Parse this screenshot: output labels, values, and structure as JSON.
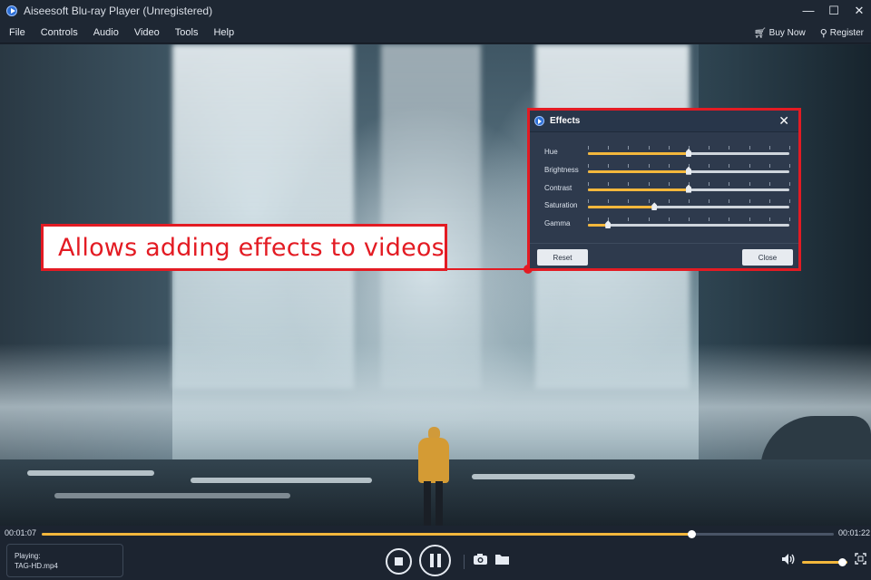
{
  "window": {
    "title": "Aiseesoft Blu-ray Player (Unregistered)",
    "minimize": "—",
    "maximize": "☐",
    "close": "✕"
  },
  "menu": {
    "items": [
      "File",
      "Controls",
      "Audio",
      "Video",
      "Tools",
      "Help"
    ],
    "buy_now": "Buy Now",
    "register": "Register"
  },
  "annotation": {
    "text": "Allows adding effects to videos",
    "color": "#e31b23"
  },
  "effects_dialog": {
    "title": "Effects",
    "close_glyph": "✕",
    "sliders": [
      {
        "label": "Hue",
        "value": 0.5,
        "show_fill": true
      },
      {
        "label": "Brightness",
        "value": 0.5,
        "show_fill": true
      },
      {
        "label": "Contrast",
        "value": 0.5,
        "show_fill": true
      },
      {
        "label": "Saturation",
        "value": 0.33,
        "show_fill": true
      },
      {
        "label": "Gamma",
        "value": 0.1,
        "show_fill": true
      }
    ],
    "reset_label": "Reset",
    "close_label": "Close"
  },
  "playback": {
    "current_time": "00:01:07",
    "total_time": "00:01:22",
    "progress": 0.82,
    "playing_label": "Playing:",
    "file_name": "TAG-HD.mp4",
    "volume": 0.88
  },
  "colors": {
    "accent": "#f3b73c",
    "background": "#1c2430"
  },
  "icons": {
    "stop": "stop-icon",
    "pause": "pause-icon",
    "snapshot": "camera-icon",
    "open": "folder-icon",
    "volume": "volume-icon",
    "fullscreen": "fullscreen-icon"
  }
}
